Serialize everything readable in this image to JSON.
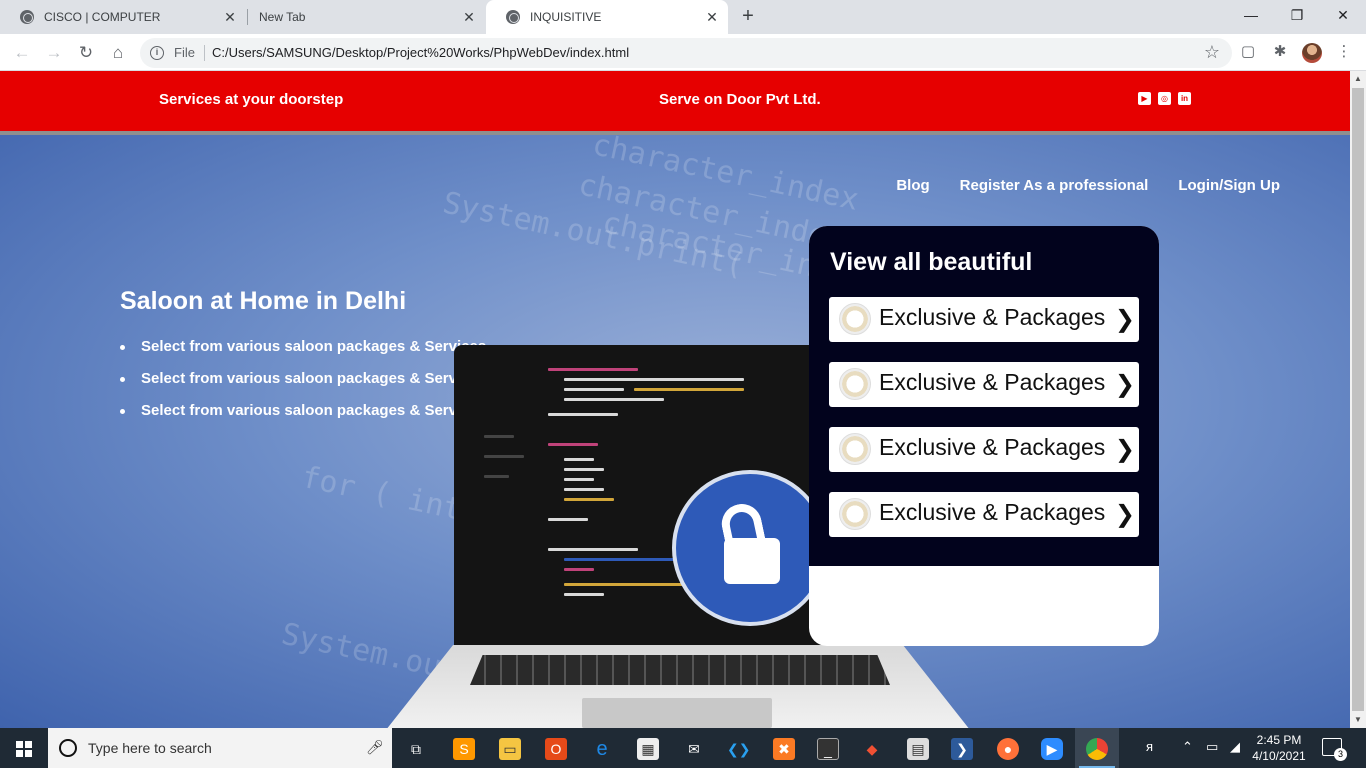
{
  "browser": {
    "tabs": [
      {
        "title": "CISCO | COMPUTER",
        "close": "✕"
      },
      {
        "title": "New Tab",
        "close": "✕"
      },
      {
        "title": "INQUISITIVE",
        "close": "✕"
      }
    ],
    "new_tab": "+",
    "window_controls": {
      "minimize": "—",
      "maximize": "❐",
      "close": "✕"
    },
    "address_bar": {
      "scheme_label": "File",
      "url": "C:/Users/SAMSUNG/Desktop/Project%20Works/PhpWebDev/index.html"
    }
  },
  "topbar": {
    "tagline": "Services at your doorstep",
    "company": "Serve on Door Pvt Ltd.",
    "social_icons": [
      "youtube-icon",
      "instagram-icon",
      "linkedin-icon"
    ],
    "background_color": "#e60000"
  },
  "nav": {
    "links": [
      "Blog",
      "Register As a professional",
      "Login/Sign Up"
    ]
  },
  "hero": {
    "title": "Saloon at Home in Delhi",
    "features": [
      "Select from various saloon packages & Services",
      "Select from various saloon packages & Services",
      "Select from various saloon packages & Services"
    ],
    "background_code_text": [
      "character_index",
      "character_index",
      "character_index",
      "System.out.print(",
      "for ( int c",
      "System.out"
    ]
  },
  "panel": {
    "title": "View all beautiful",
    "items": [
      {
        "label": "Exclusive & Packages"
      },
      {
        "label": "Exclusive & Packages"
      },
      {
        "label": "Exclusive & Packages"
      },
      {
        "label": "Exclusive & Packages"
      }
    ],
    "background_color": "#02031d"
  },
  "taskbar": {
    "search_placeholder": "Type here to search",
    "apps": [
      "task-view-icon",
      "sublime-text-icon",
      "file-explorer-icon",
      "office-icon",
      "edge-icon",
      "store-icon",
      "mail-icon",
      "vscode-icon",
      "xampp-icon",
      "terminal-icon",
      "git-icon",
      "pdf-icon",
      "powershell-icon",
      "firefox-icon",
      "zoom-icon",
      "chrome-icon"
    ],
    "time": "2:45 PM",
    "date": "4/10/2021",
    "notification_count": "3"
  }
}
